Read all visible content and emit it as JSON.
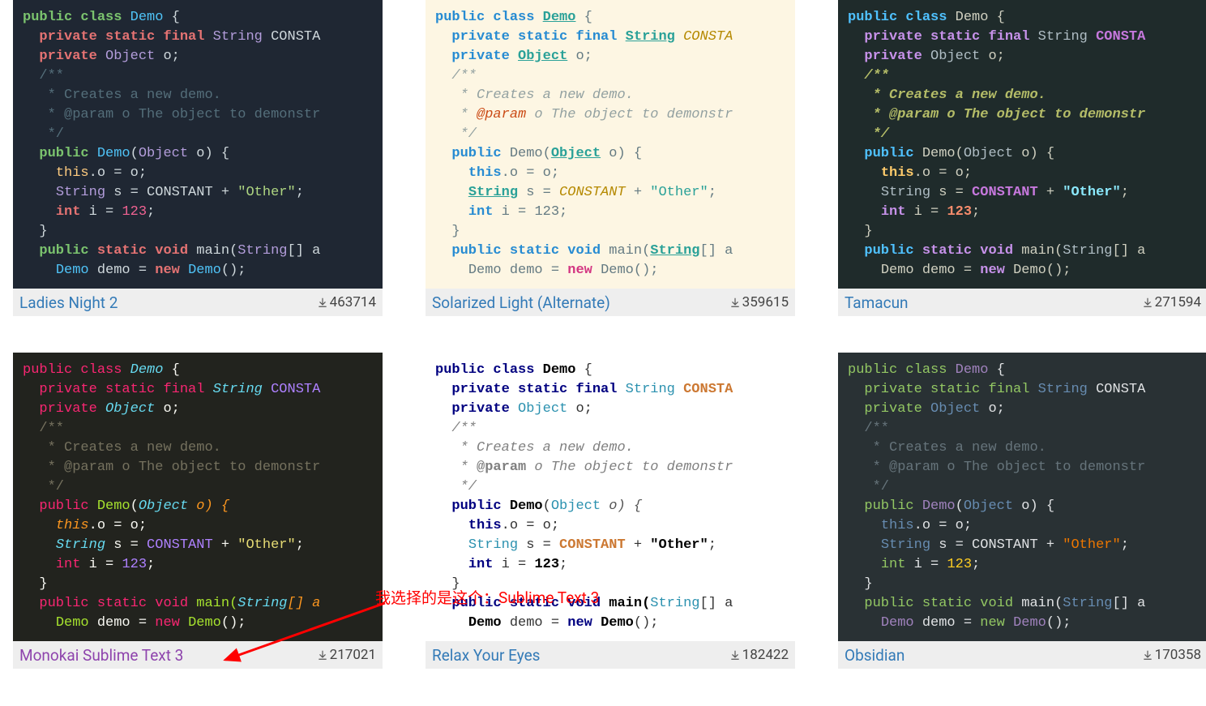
{
  "code": {
    "line1_public": "public",
    "line1_class": "class",
    "line1_demo": "Demo",
    "line1_brace": " {",
    "line2_private": "private",
    "line2_static": "static",
    "line2_final": "final",
    "line2_string": "String",
    "line2_constant": "CONSTA",
    "line3_private": "private",
    "line3_object": "Object",
    "line3_o": " o;",
    "c1": "/**",
    "c2": " * Creates a new demo.",
    "c3a": " * ",
    "c3_param": "@param",
    "c3b": " o The object to demonstr",
    "c4": " */",
    "ctor_public": "public",
    "ctor_demo": "Demo",
    "ctor_lp": "(",
    "ctor_object": "Object",
    "ctor_o": " o) {",
    "this_kw": "this",
    "this_rest": ".o = o;",
    "s_type": "String",
    "s_rest1": " s = ",
    "s_const": "CONSTANT",
    "s_plus": " + ",
    "s_str": "\"Other\"",
    "s_semi": ";",
    "int_kw": "int",
    "int_rest": " i = ",
    "int_num": "123",
    "int_semi": ";",
    "rbrace": "}",
    "main_public": "public",
    "main_static": "static",
    "main_void": "void",
    "main_main": " main(",
    "main_str": "String",
    "main_arr": "[] a",
    "dm_demo1": "Demo",
    "dm_var": " demo = ",
    "dm_new": "new",
    "dm_sp": " ",
    "dm_demo2": "Demo",
    "dm_call": "();"
  },
  "themes": [
    {
      "name": "Ladies Night 2",
      "downloads": "463714"
    },
    {
      "name": "Solarized Light (Alternate)",
      "downloads": "359615"
    },
    {
      "name": "Tamacun",
      "downloads": "271594"
    },
    {
      "name": "Monokai Sublime Text 3",
      "downloads": "217021"
    },
    {
      "name": "Relax Your Eyes",
      "downloads": "182422"
    },
    {
      "name": "Obsidian",
      "downloads": "170358"
    }
  ],
  "annotation": "我选择的是这个：Sublime Text 3"
}
